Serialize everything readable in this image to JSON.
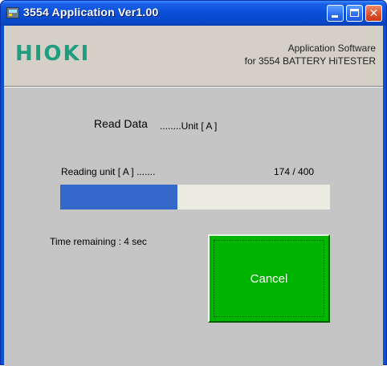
{
  "window": {
    "title": "3554 Application   Ver1.00",
    "min_glyph": "",
    "max_glyph": "",
    "close_glyph": "✕"
  },
  "header": {
    "logo_text": "HIOKI",
    "logo_color": "#1f9e7e",
    "app_line1": "Application Software",
    "app_line2": "for 3554 BATTERY HiTESTER"
  },
  "status": {
    "read_data_label": "Read Data",
    "read_data_unit": "........Unit [ A ]",
    "reading_label": "Reading unit [ A ] .......",
    "count_text": "174 / 400",
    "progress_value": 174,
    "progress_max": 400,
    "progress_color": "#3468c9",
    "time_remaining": "Time remaining :  4 sec"
  },
  "actions": {
    "cancel_label": "Cancel",
    "cancel_color": "#00b400"
  }
}
